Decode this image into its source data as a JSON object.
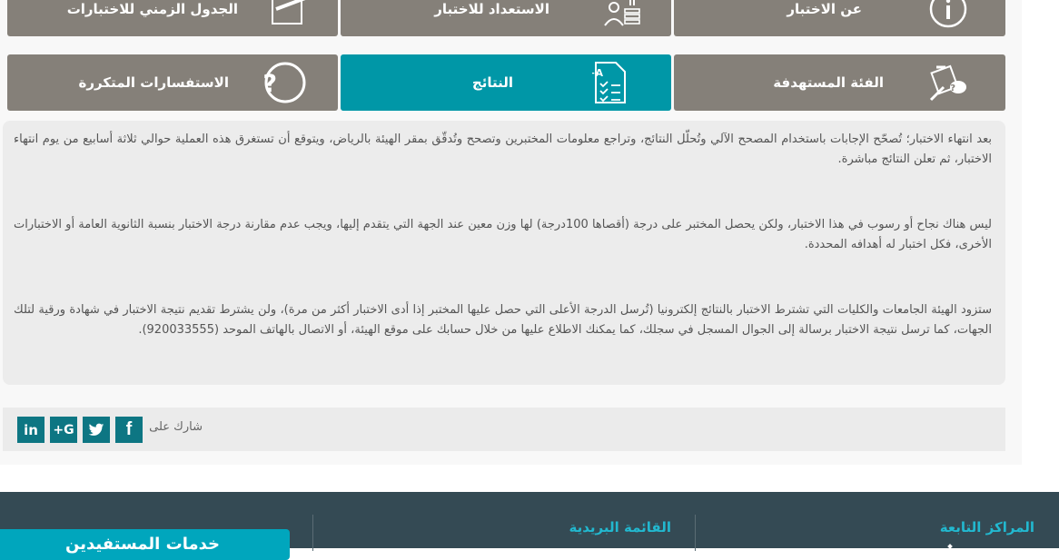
{
  "tabs_row1": [
    {
      "label": "عن الاختبار",
      "icon": "info-icon"
    },
    {
      "label": "الاستعداد للاختبار",
      "icon": "study-person-icon"
    },
    {
      "label": "الجدول الزمني للاختبارات",
      "icon": "schedule-pencil-icon"
    }
  ],
  "tabs_row2": [
    {
      "label": "الفئة المستهدفة",
      "icon": "target-audience-icon"
    },
    {
      "label": "النتائج",
      "icon": "results-document-icon",
      "active": true
    },
    {
      "label": "الاستفسارات المتكررة",
      "icon": "question-icon"
    }
  ],
  "content": {
    "paragraph1": "بعد انتهاء الاختبار؛ تُصحّح الإجابات باستخدام المصحح الآلي وتُحلّل النتائج، وتراجع معلومات المختبرين وتصحح وتُدقّق بمقر الهيئة بالرياض، ويتوقع أن تستغرق هذه العملية حوالي ثلاثة أسابيع من يوم انتهاء الاختبار، ثم تعلن النتائج مباشرة.",
    "paragraph2": "ليس هناك نجاح أو رسوب في هذا الاختبار، ولكن يحصل المختبر على درجة (أقصاها 100درجة) لها وزن معين عند الجهة التي يتقدم إليها، ويجب عدم مقارنة درجة الاختبار بنسبة الثانوية العامة أو الاختبارات الأخرى، فكل اختبار له أهدافه المحددة.",
    "paragraph3": "ستزود الهيئة الجامعات والكليات التي تشترط الاختبار بالنتائج إلكترونيا (تُرسل الدرجة الأعلى التي حصل عليها المختبر إذا أدى الاختبار أكثر من مرة)، ولن يشترط تقديم نتيجة الاختبار في شهادة ورقية لتلك الجهات، كما ترسل نتيجة الاختبار برسالة إلى الجوال المسجل في سجلك، كما يمكنك الاطلاع عليها من خلال حسابك على موقع الهيئة، أو الاتصال بالهاتف الموحد (920033555)."
  },
  "share": {
    "label": "شارك على",
    "facebook": "f",
    "twitter": "twitter-icon",
    "googleplus": "G+",
    "linkedin": "in"
  },
  "footer": {
    "col1_title": "المراكز التابعة",
    "col2_title": "القائمة البريدية",
    "services_button": "خدمات المستفيدين"
  },
  "colors": {
    "tab_bg": "#858079",
    "tab_active": "#0097a7",
    "social_bg": "#0d7683",
    "footer_bg": "#344a54",
    "footer_title": "#22b8cf"
  }
}
